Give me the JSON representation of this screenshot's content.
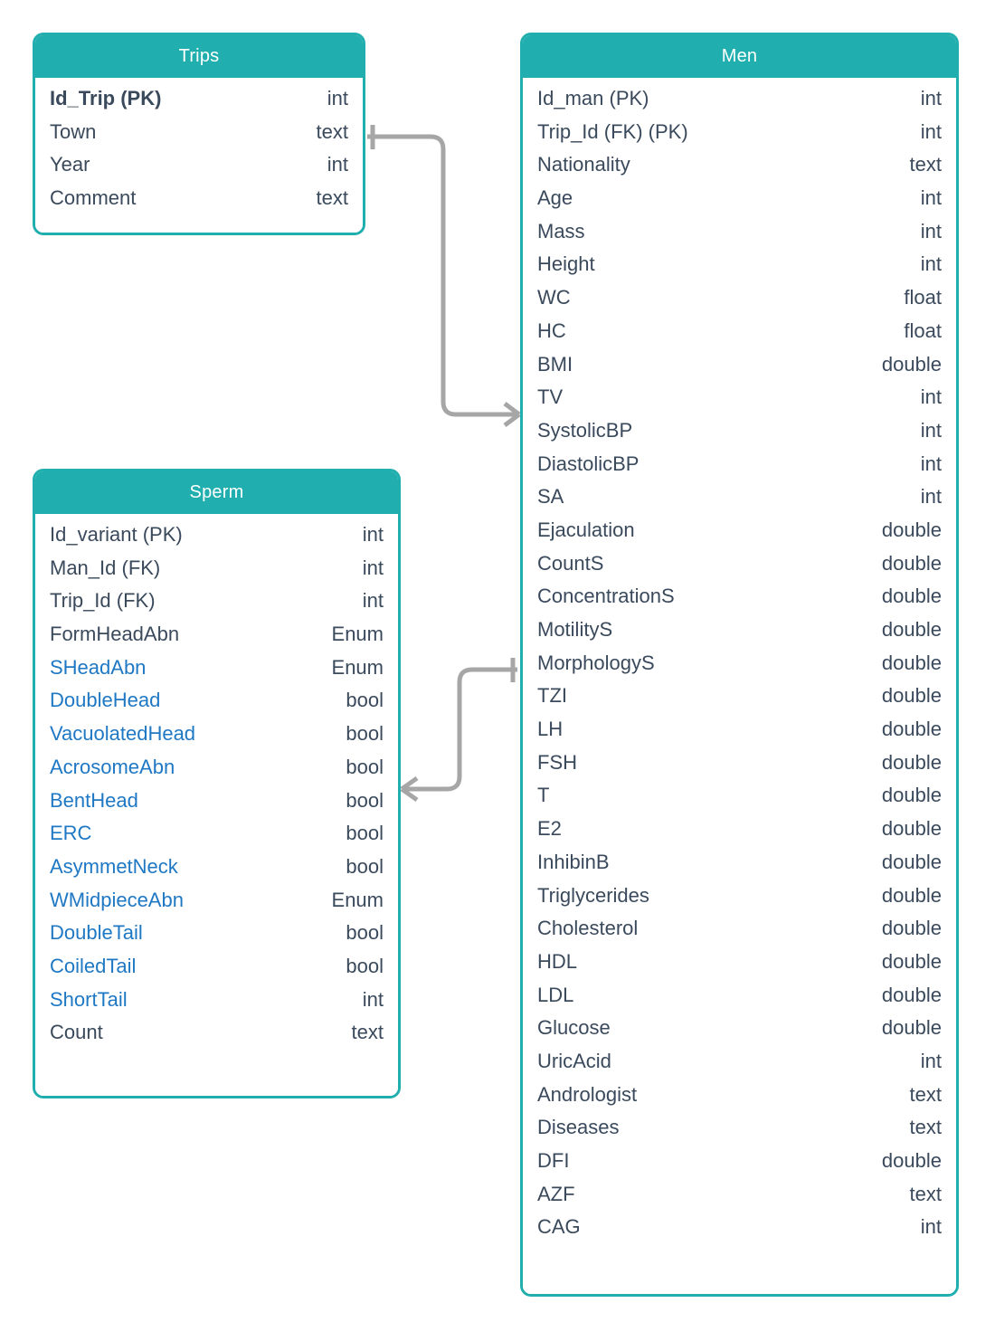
{
  "diagram": {
    "kind": "entity-relationship-diagram",
    "colors": {
      "header_background": "#20AFAE",
      "border": "#20AFAE",
      "body_background": "#FFFFFF",
      "field_text": "#3A4A5C",
      "highlight_field_text": "#1F78C4",
      "relationship_line": "#A6A6A6"
    }
  },
  "entities": {
    "trips": {
      "title": "Trips",
      "fields": [
        {
          "name": "Id_Trip",
          "key": "(PK)",
          "label": "Id_Trip (PK)",
          "type": "int",
          "bold": true,
          "highlight": false
        },
        {
          "name": "Town",
          "key": "",
          "label": "Town",
          "type": "text",
          "bold": false,
          "highlight": false
        },
        {
          "name": "Year",
          "key": "",
          "label": "Year",
          "type": "int",
          "bold": false,
          "highlight": false
        },
        {
          "name": "Comment",
          "key": "",
          "label": "Comment",
          "type": "text",
          "bold": false,
          "highlight": false
        }
      ]
    },
    "sperm": {
      "title": "Sperm",
      "fields": [
        {
          "name": "Id_variant",
          "key": "(PK)",
          "label": "Id_variant (PK)",
          "type": "int",
          "bold": false,
          "highlight": false
        },
        {
          "name": "Man_Id",
          "key": "(FK)",
          "label": "Man_Id (FK)",
          "type": "int",
          "bold": false,
          "highlight": false
        },
        {
          "name": "Trip_Id",
          "key": "(FK)",
          "label": "Trip_Id  (FK)",
          "type": "int",
          "bold": false,
          "highlight": false
        },
        {
          "name": "FormHeadAbn",
          "key": "",
          "label": "FormHeadAbn",
          "type": "Enum",
          "bold": false,
          "highlight": false
        },
        {
          "name": "SHeadAbn",
          "key": "",
          "label": "SHeadAbn",
          "type": "Enum",
          "bold": false,
          "highlight": true
        },
        {
          "name": "DoubleHead",
          "key": "",
          "label": "DoubleHead",
          "type": "bool",
          "bold": false,
          "highlight": true
        },
        {
          "name": "VacuolatedHead",
          "key": "",
          "label": "VacuolatedHead",
          "type": "bool",
          "bold": false,
          "highlight": true
        },
        {
          "name": "AcrosomeAbn",
          "key": "",
          "label": "AcrosomeAbn",
          "type": "bool",
          "bold": false,
          "highlight": true
        },
        {
          "name": "BentHead",
          "key": "",
          "label": "BentHead",
          "type": "bool",
          "bold": false,
          "highlight": true
        },
        {
          "name": "ERC",
          "key": "",
          "label": "ERC",
          "type": "bool",
          "bold": false,
          "highlight": true
        },
        {
          "name": "AsymmetNeck",
          "key": "",
          "label": "AsymmetNeck",
          "type": "bool",
          "bold": false,
          "highlight": true
        },
        {
          "name": "WMidpieceAbn",
          "key": "",
          "label": "WMidpieceAbn",
          "type": "Enum",
          "bold": false,
          "highlight": true
        },
        {
          "name": "DoubleTail",
          "key": "",
          "label": "DoubleTail",
          "type": "bool",
          "bold": false,
          "highlight": true
        },
        {
          "name": "CoiledTail",
          "key": "",
          "label": "CoiledTail",
          "type": "bool",
          "bold": false,
          "highlight": true
        },
        {
          "name": "ShortTail",
          "key": "",
          "label": "ShortTail",
          "type": "int",
          "bold": false,
          "highlight": true
        },
        {
          "name": "Count",
          "key": "",
          "label": "Count",
          "type": "text",
          "bold": false,
          "highlight": false
        }
      ]
    },
    "men": {
      "title": "Men",
      "fields": [
        {
          "name": "Id_man",
          "key": "(PK)",
          "label": "Id_man (PK)",
          "type": "int",
          "bold": false,
          "highlight": false
        },
        {
          "name": "Trip_Id",
          "key": "(FK) (PK)",
          "label": "Trip_Id  (FK) (PK)",
          "type": "int",
          "bold": false,
          "highlight": false
        },
        {
          "name": "Nationality",
          "key": "",
          "label": "Nationality",
          "type": "text",
          "bold": false,
          "highlight": false
        },
        {
          "name": "Age",
          "key": "",
          "label": "Age",
          "type": "int",
          "bold": false,
          "highlight": false
        },
        {
          "name": "Mass",
          "key": "",
          "label": "Mass",
          "type": "int",
          "bold": false,
          "highlight": false
        },
        {
          "name": "Height",
          "key": "",
          "label": "Height",
          "type": "int",
          "bold": false,
          "highlight": false
        },
        {
          "name": "WC",
          "key": "",
          "label": "WC",
          "type": "float",
          "bold": false,
          "highlight": false
        },
        {
          "name": "HC",
          "key": "",
          "label": "HC",
          "type": "float",
          "bold": false,
          "highlight": false
        },
        {
          "name": "BMI",
          "key": "",
          "label": "BMI",
          "type": "double",
          "bold": false,
          "highlight": false
        },
        {
          "name": "TV",
          "key": "",
          "label": "TV",
          "type": "int",
          "bold": false,
          "highlight": false
        },
        {
          "name": "SystolicBP",
          "key": "",
          "label": "SystolicBP",
          "type": "int",
          "bold": false,
          "highlight": false
        },
        {
          "name": "DiastolicBP",
          "key": "",
          "label": "DiastolicBP",
          "type": "int",
          "bold": false,
          "highlight": false
        },
        {
          "name": "SA",
          "key": "",
          "label": "SA",
          "type": "int",
          "bold": false,
          "highlight": false
        },
        {
          "name": "Ejaculation",
          "key": "",
          "label": "Ejaculation",
          "type": "double",
          "bold": false,
          "highlight": false
        },
        {
          "name": "CountS",
          "key": "",
          "label": "CountS",
          "type": "double",
          "bold": false,
          "highlight": false
        },
        {
          "name": "ConcentrationS",
          "key": "",
          "label": "ConcentrationS",
          "type": "double",
          "bold": false,
          "highlight": false
        },
        {
          "name": "MotilityS",
          "key": "",
          "label": "MotilityS",
          "type": "double",
          "bold": false,
          "highlight": false
        },
        {
          "name": "MorphologyS",
          "key": "",
          "label": "MorphologyS",
          "type": "double",
          "bold": false,
          "highlight": false
        },
        {
          "name": "TZI",
          "key": "",
          "label": "TZI",
          "type": "double",
          "bold": false,
          "highlight": false
        },
        {
          "name": "LH",
          "key": "",
          "label": "LH",
          "type": "double",
          "bold": false,
          "highlight": false
        },
        {
          "name": "FSH",
          "key": "",
          "label": "FSH",
          "type": "double",
          "bold": false,
          "highlight": false
        },
        {
          "name": "T",
          "key": "",
          "label": "T",
          "type": "double",
          "bold": false,
          "highlight": false
        },
        {
          "name": "E2",
          "key": "",
          "label": "E2",
          "type": "double",
          "bold": false,
          "highlight": false
        },
        {
          "name": "InhibinB",
          "key": "",
          "label": "InhibinB",
          "type": "double",
          "bold": false,
          "highlight": false
        },
        {
          "name": "Triglycerides",
          "key": "",
          "label": "Triglycerides",
          "type": "double",
          "bold": false,
          "highlight": false
        },
        {
          "name": "Cholesterol",
          "key": "",
          "label": "Cholesterol",
          "type": "double",
          "bold": false,
          "highlight": false
        },
        {
          "name": "HDL",
          "key": "",
          "label": "HDL",
          "type": "double",
          "bold": false,
          "highlight": false
        },
        {
          "name": "LDL",
          "key": "",
          "label": "LDL",
          "type": "double",
          "bold": false,
          "highlight": false
        },
        {
          "name": "Glucose",
          "key": "",
          "label": "Glucose",
          "type": "double",
          "bold": false,
          "highlight": false
        },
        {
          "name": "UricAcid",
          "key": "",
          "label": "UricAcid",
          "type": "int",
          "bold": false,
          "highlight": false
        },
        {
          "name": "Andrologist",
          "key": "",
          "label": "Andrologist",
          "type": "text",
          "bold": false,
          "highlight": false
        },
        {
          "name": "Diseases",
          "key": "",
          "label": "Diseases",
          "type": "text",
          "bold": false,
          "highlight": false
        },
        {
          "name": "DFI",
          "key": "",
          "label": "DFI",
          "type": "double",
          "bold": false,
          "highlight": false
        },
        {
          "name": "AZF",
          "key": "",
          "label": "AZF",
          "type": "text",
          "bold": false,
          "highlight": false
        },
        {
          "name": "CAG",
          "key": "",
          "label": "CAG",
          "type": "int",
          "bold": false,
          "highlight": false
        }
      ]
    }
  },
  "relationships": [
    {
      "name": "trips-to-men",
      "from_entity": "Trips",
      "from_field": "Id_Trip",
      "from_cardinality": "one",
      "to_entity": "Men",
      "to_field": "Trip_Id",
      "to_cardinality": "many"
    },
    {
      "name": "men-to-sperm",
      "from_entity": "Men",
      "from_field": "MotilityS",
      "from_cardinality": "one",
      "to_entity": "Sperm",
      "to_field": "AcrosomeAbn",
      "to_cardinality": "many"
    }
  ]
}
